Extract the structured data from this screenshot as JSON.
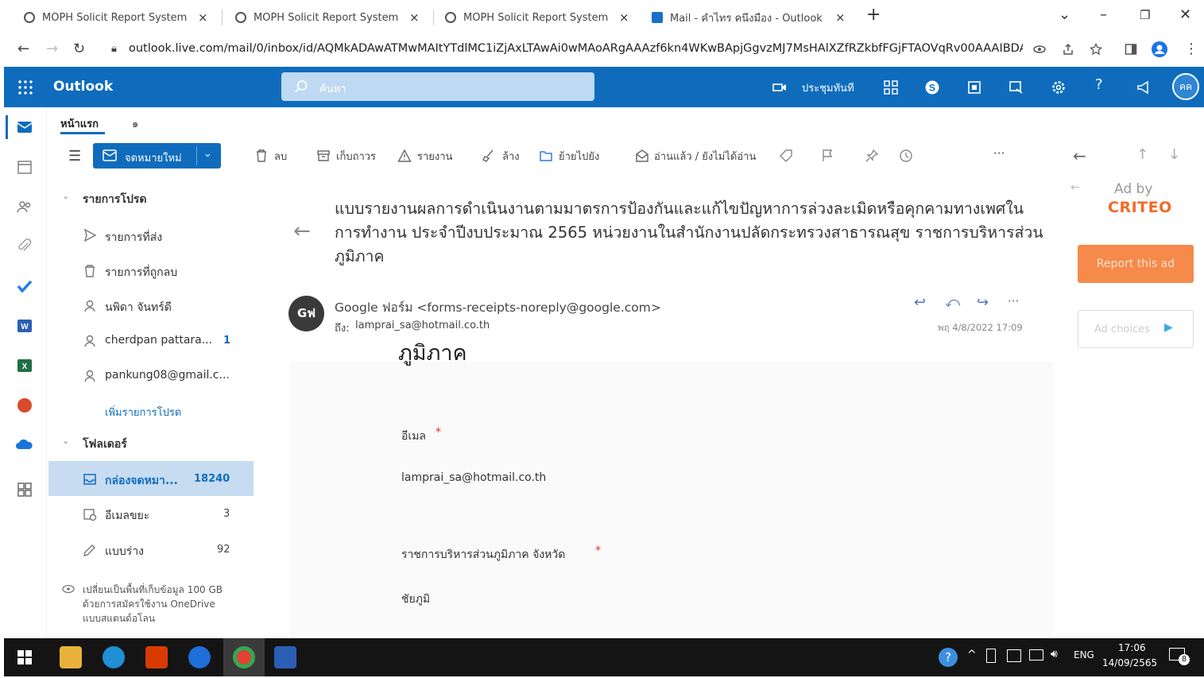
{
  "browser": {
    "tabs": [
      {
        "title": "MOPH Solicit Report System : M",
        "close": "×"
      },
      {
        "title": "MOPH Solicit Report System : M",
        "close": "×"
      },
      {
        "title": "MOPH Solicit Report System : M",
        "close": "×"
      },
      {
        "title": "Mail - คำไทร คนึงมือง - Outlook",
        "close": "×"
      }
    ],
    "new_tab": "+",
    "url": "outlook.live.com/mail/0/inbox/id/AQMkADAwATMwMAItYTdlMC1iZjAxLTAwAi0wMAoARgAAAzf6kn4WKwBApjGgvzMJ7MsHAlXZfRZkbfFGjFTAOVqRv00AAAIBDAA..."
  },
  "outlook": {
    "brand": "Outlook",
    "search_placeholder": "ค้นหา",
    "meet_now": "ประชุมทันที",
    "avatar_initials": "คค"
  },
  "nav_tabs": {
    "home": "หน้าแรก",
    "more": "๑"
  },
  "toolbar": {
    "new_mail": "จดหมายใหม่",
    "delete": "ลบ",
    "archive": "เก็บถาวร",
    "report": "รายงาน",
    "sweep": "ล้าง",
    "move_to": "ย้ายไปยัง",
    "read_unread": "อ่านแล้ว / ยังไม่ได้อ่าน",
    "more": "···"
  },
  "folders": {
    "favorites_header": "รายการโปรด",
    "favorites": [
      {
        "label": "รายการที่ส่ง",
        "count": ""
      },
      {
        "label": "รายการที่ถูกลบ",
        "count": ""
      },
      {
        "label": "นพิดา จันทร์ดี",
        "count": ""
      },
      {
        "label": "cherdpan pattara...",
        "count": "1"
      },
      {
        "label": "pankung08@gmail.c...",
        "count": ""
      }
    ],
    "add_favorite": "เพิ่มรายการโปรด",
    "folders_header": "โฟลเดอร์",
    "folder_list": [
      {
        "label": "กล่องจดหมา...",
        "count": "18240"
      },
      {
        "label": "อีเมลขยะ",
        "count": "3"
      },
      {
        "label": "แบบร่าง",
        "count": "92"
      }
    ],
    "storage_note": "เปลี่ยนเป็นพื้นที่เก็บข้อมูล 100 GB ด้วยการสมัครใช้งาน OneDrive แบบสแตนด์อโลน"
  },
  "message": {
    "subject": "แบบรายงานผลการดำเนินงานตามมาตรการป้องกันและแก้ไขปัญหาการล่วงละเมิดหรือคุกคามทางเพศในการทำงาน ประจำปีงบประมาณ 2565 หน่วยงานในสำนักงานปลัดกระทรวงสาธารณสุข ราชการบริหารส่วนภูมิภาค",
    "avatar": "Gฟ",
    "sender": "Google ฟอร์ม <forms-receipts-noreply@google.com>",
    "to_label": "ถึง:",
    "to": "lamprai_sa@hotmail.co.th",
    "date": "พฤ 4/8/2022 17:09",
    "body_heading": "ภูมิภาค",
    "field1_label": "อีเมล",
    "required_mark": "*",
    "field1_value": "lamprai_sa@hotmail.co.th",
    "field2_label": "ราชการบริหารส่วนภูมิภาค จังหวัด",
    "field2_value": "ชัยภูมิ"
  },
  "ad": {
    "ad_by": "Ad by",
    "brand": "CRITEO",
    "report": "Report this ad",
    "choices": "Ad choices"
  },
  "taskbar": {
    "lang": "ENG",
    "time": "17:06",
    "date": "14/09/2565",
    "notif_count": "8"
  },
  "colors": {
    "outlook_blue": "#0f6cbd",
    "selected_folder": "#c7dcf1",
    "criteo": "#f26b2a",
    "ad_button": "#f58a4b"
  }
}
